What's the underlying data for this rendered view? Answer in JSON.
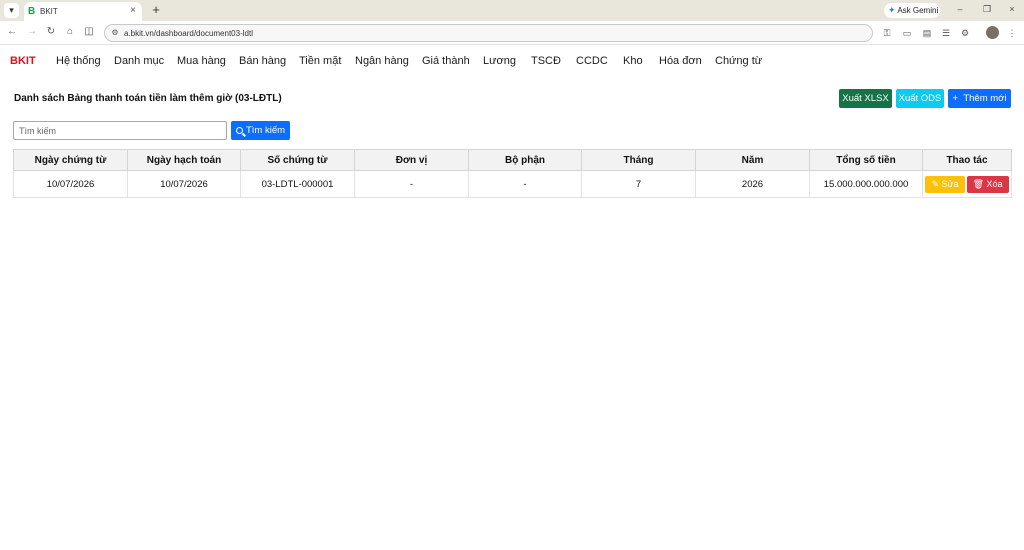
{
  "browser": {
    "tab_title": "BKIT",
    "tab_favicon": "B",
    "url": "a.bkit.vn/dashboard/document03-ldtl",
    "ask_gemini": "Ask Gemini"
  },
  "app": {
    "brand": "BKIT",
    "nav": [
      "Hệ thống",
      "Danh mục",
      "Mua hàng",
      "Bán hàng",
      "Tiền mặt",
      "Ngân hàng",
      "Giá thành",
      "Lương",
      "TSCĐ",
      "CCDC",
      "Kho",
      "Hóa đơn",
      "Chứng từ"
    ]
  },
  "page": {
    "title": "Danh sách Bảng thanh toán tiền làm thêm giờ (03-LĐTL)",
    "export_xlsx": "Xuất XLSX",
    "export_ods": "Xuất ODS",
    "add_new": "Thêm mới",
    "search_placeholder": "Tìm kiếm",
    "search_button": "Tìm kiếm"
  },
  "table": {
    "headers": [
      "Ngày chứng từ",
      "Ngày hạch toán",
      "Số chứng từ",
      "Đơn vị",
      "Bộ phận",
      "Tháng",
      "Năm",
      "Tổng số tiền",
      "Thao tác"
    ],
    "rows": [
      {
        "ngay_chung_tu": "10/07/2026",
        "ngay_hach_toan": "10/07/2026",
        "so_chung_tu": "03-LDTL-000001",
        "don_vi": "-",
        "bo_phan": "-",
        "thang": "7",
        "nam": "2026",
        "tong_so_tien": "15.000.000.000.000",
        "edit_label": "Sửa",
        "delete_label": "Xóa"
      }
    ]
  },
  "colors": {
    "brand": "#e0101c",
    "xlsx": "#157347",
    "ods": "#0dcaf0",
    "primary": "#0d6efd",
    "edit": "#ffc107",
    "delete": "#dc3545"
  }
}
